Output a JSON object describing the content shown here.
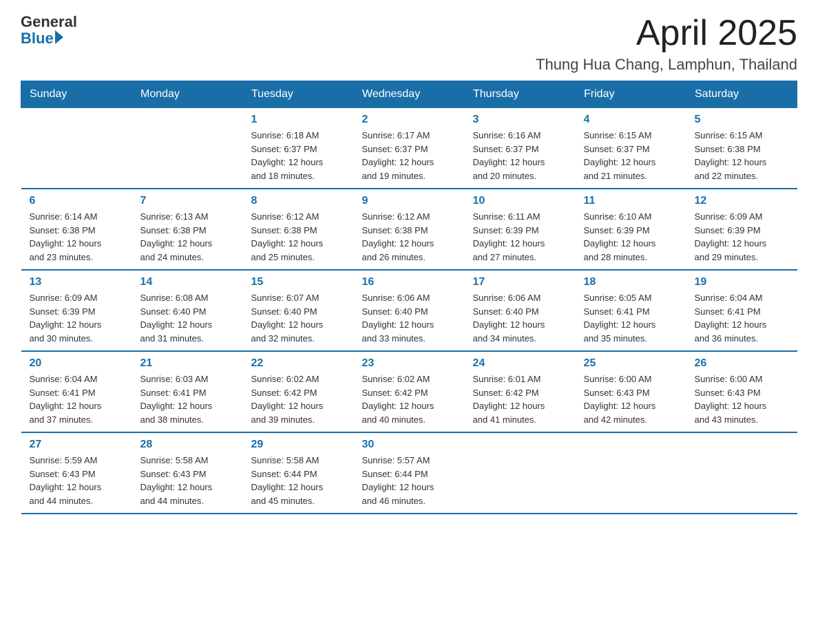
{
  "header": {
    "logo_general": "General",
    "logo_blue": "Blue",
    "month_title": "April 2025",
    "location": "Thung Hua Chang, Lamphun, Thailand"
  },
  "weekdays": [
    "Sunday",
    "Monday",
    "Tuesday",
    "Wednesday",
    "Thursday",
    "Friday",
    "Saturday"
  ],
  "weeks": [
    [
      {
        "day": "",
        "info": ""
      },
      {
        "day": "",
        "info": ""
      },
      {
        "day": "1",
        "info": "Sunrise: 6:18 AM\nSunset: 6:37 PM\nDaylight: 12 hours\nand 18 minutes."
      },
      {
        "day": "2",
        "info": "Sunrise: 6:17 AM\nSunset: 6:37 PM\nDaylight: 12 hours\nand 19 minutes."
      },
      {
        "day": "3",
        "info": "Sunrise: 6:16 AM\nSunset: 6:37 PM\nDaylight: 12 hours\nand 20 minutes."
      },
      {
        "day": "4",
        "info": "Sunrise: 6:15 AM\nSunset: 6:37 PM\nDaylight: 12 hours\nand 21 minutes."
      },
      {
        "day": "5",
        "info": "Sunrise: 6:15 AM\nSunset: 6:38 PM\nDaylight: 12 hours\nand 22 minutes."
      }
    ],
    [
      {
        "day": "6",
        "info": "Sunrise: 6:14 AM\nSunset: 6:38 PM\nDaylight: 12 hours\nand 23 minutes."
      },
      {
        "day": "7",
        "info": "Sunrise: 6:13 AM\nSunset: 6:38 PM\nDaylight: 12 hours\nand 24 minutes."
      },
      {
        "day": "8",
        "info": "Sunrise: 6:12 AM\nSunset: 6:38 PM\nDaylight: 12 hours\nand 25 minutes."
      },
      {
        "day": "9",
        "info": "Sunrise: 6:12 AM\nSunset: 6:38 PM\nDaylight: 12 hours\nand 26 minutes."
      },
      {
        "day": "10",
        "info": "Sunrise: 6:11 AM\nSunset: 6:39 PM\nDaylight: 12 hours\nand 27 minutes."
      },
      {
        "day": "11",
        "info": "Sunrise: 6:10 AM\nSunset: 6:39 PM\nDaylight: 12 hours\nand 28 minutes."
      },
      {
        "day": "12",
        "info": "Sunrise: 6:09 AM\nSunset: 6:39 PM\nDaylight: 12 hours\nand 29 minutes."
      }
    ],
    [
      {
        "day": "13",
        "info": "Sunrise: 6:09 AM\nSunset: 6:39 PM\nDaylight: 12 hours\nand 30 minutes."
      },
      {
        "day": "14",
        "info": "Sunrise: 6:08 AM\nSunset: 6:40 PM\nDaylight: 12 hours\nand 31 minutes."
      },
      {
        "day": "15",
        "info": "Sunrise: 6:07 AM\nSunset: 6:40 PM\nDaylight: 12 hours\nand 32 minutes."
      },
      {
        "day": "16",
        "info": "Sunrise: 6:06 AM\nSunset: 6:40 PM\nDaylight: 12 hours\nand 33 minutes."
      },
      {
        "day": "17",
        "info": "Sunrise: 6:06 AM\nSunset: 6:40 PM\nDaylight: 12 hours\nand 34 minutes."
      },
      {
        "day": "18",
        "info": "Sunrise: 6:05 AM\nSunset: 6:41 PM\nDaylight: 12 hours\nand 35 minutes."
      },
      {
        "day": "19",
        "info": "Sunrise: 6:04 AM\nSunset: 6:41 PM\nDaylight: 12 hours\nand 36 minutes."
      }
    ],
    [
      {
        "day": "20",
        "info": "Sunrise: 6:04 AM\nSunset: 6:41 PM\nDaylight: 12 hours\nand 37 minutes."
      },
      {
        "day": "21",
        "info": "Sunrise: 6:03 AM\nSunset: 6:41 PM\nDaylight: 12 hours\nand 38 minutes."
      },
      {
        "day": "22",
        "info": "Sunrise: 6:02 AM\nSunset: 6:42 PM\nDaylight: 12 hours\nand 39 minutes."
      },
      {
        "day": "23",
        "info": "Sunrise: 6:02 AM\nSunset: 6:42 PM\nDaylight: 12 hours\nand 40 minutes."
      },
      {
        "day": "24",
        "info": "Sunrise: 6:01 AM\nSunset: 6:42 PM\nDaylight: 12 hours\nand 41 minutes."
      },
      {
        "day": "25",
        "info": "Sunrise: 6:00 AM\nSunset: 6:43 PM\nDaylight: 12 hours\nand 42 minutes."
      },
      {
        "day": "26",
        "info": "Sunrise: 6:00 AM\nSunset: 6:43 PM\nDaylight: 12 hours\nand 43 minutes."
      }
    ],
    [
      {
        "day": "27",
        "info": "Sunrise: 5:59 AM\nSunset: 6:43 PM\nDaylight: 12 hours\nand 44 minutes."
      },
      {
        "day": "28",
        "info": "Sunrise: 5:58 AM\nSunset: 6:43 PM\nDaylight: 12 hours\nand 44 minutes."
      },
      {
        "day": "29",
        "info": "Sunrise: 5:58 AM\nSunset: 6:44 PM\nDaylight: 12 hours\nand 45 minutes."
      },
      {
        "day": "30",
        "info": "Sunrise: 5:57 AM\nSunset: 6:44 PM\nDaylight: 12 hours\nand 46 minutes."
      },
      {
        "day": "",
        "info": ""
      },
      {
        "day": "",
        "info": ""
      },
      {
        "day": "",
        "info": ""
      }
    ]
  ]
}
